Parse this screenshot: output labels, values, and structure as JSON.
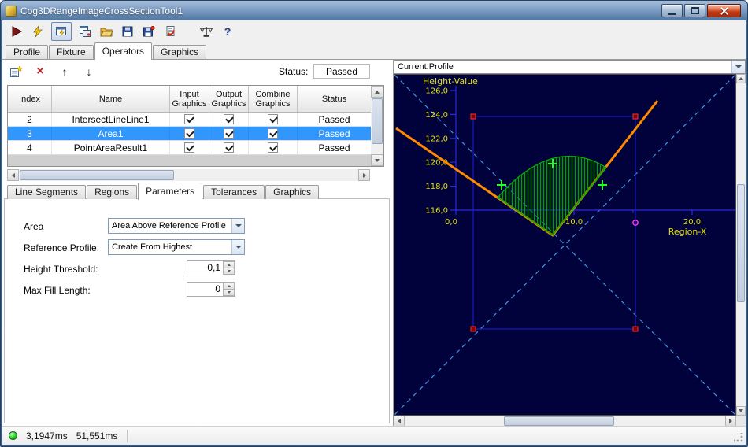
{
  "window": {
    "title": "Cog3DRangeImageCrossSectionTool1"
  },
  "toolbar": {
    "icons": [
      {
        "name": "run"
      },
      {
        "name": "run-continuous"
      },
      {
        "name": "tool-display"
      },
      {
        "name": "result-display"
      },
      {
        "name": "open-file"
      },
      {
        "name": "save-file"
      },
      {
        "name": "save-results"
      },
      {
        "name": "import"
      },
      {
        "name": "measure"
      },
      {
        "name": "help",
        "glyph": "?"
      }
    ]
  },
  "main_tabs": {
    "selected": "Operators",
    "items": [
      {
        "label": "Profile"
      },
      {
        "label": "Fixture"
      },
      {
        "label": "Operators"
      },
      {
        "label": "Graphics"
      }
    ]
  },
  "operators": {
    "toolbar": {
      "add": {
        "name": "add-operator"
      },
      "delete": {
        "name": "delete-operator",
        "glyph": "×"
      },
      "move_up": {
        "name": "move-up",
        "glyph": "↑"
      },
      "move_down": {
        "name": "move-down",
        "glyph": "↓"
      },
      "status_label": "Status:",
      "status_value": "Passed"
    },
    "table": {
      "headers": {
        "index": "Index",
        "name": "Name",
        "input": "Input Graphics",
        "output": "Output Graphics",
        "combine": "Combine Graphics",
        "status": "Status"
      },
      "rows": [
        {
          "index": "2",
          "name": "IntersectLineLine1",
          "input_checked": true,
          "output_checked": true,
          "combine_checked": true,
          "status": "Passed",
          "selected": false
        },
        {
          "index": "3",
          "name": "Area1",
          "input_checked": true,
          "output_checked": true,
          "combine_checked": true,
          "status": "Passed",
          "selected": true
        },
        {
          "index": "4",
          "name": "PointAreaResult1",
          "input_checked": true,
          "output_checked": true,
          "combine_checked": true,
          "status": "Passed",
          "selected": false
        }
      ]
    }
  },
  "sub_tabs": {
    "selected": "Parameters",
    "items": [
      {
        "label": "Line Segments"
      },
      {
        "label": "Regions"
      },
      {
        "label": "Parameters"
      },
      {
        "label": "Tolerances"
      },
      {
        "label": "Graphics"
      }
    ]
  },
  "parameters": {
    "area_label": "Area",
    "area_value": "Area Above Reference Profile",
    "reference_profile_label": "Reference Profile:",
    "reference_profile_value": "Create From Highest",
    "height_threshold_label": "Height Threshold:",
    "height_threshold_value": "0,1",
    "max_fill_length_label": "Max Fill Length:",
    "max_fill_length_value": "0"
  },
  "profile_view": {
    "source": "Current.Profile",
    "y_axis_label": "Height-Value",
    "x_axis_label": "Region-X",
    "y_ticks": [
      "126,0",
      "124,0",
      "122,0",
      "120,0",
      "118,0",
      "116,0"
    ],
    "x_ticks": [
      "0,0",
      "10,0",
      "20,0"
    ],
    "colors": {
      "background": "#01013c",
      "axis": "#2a2ae0",
      "tick_text": "#e0e000",
      "diagonal_guides": "#3f97e0",
      "region_outline": "#1a1ac0",
      "corner_handles": "#ff3030",
      "profile_line": "#ff8a00",
      "area_hatch": "#00b400",
      "point_markers": "#22ff22",
      "pick_marker": "#ff2cff"
    }
  },
  "status_bar": {
    "led_color": "#18c018",
    "time_1": "3,1947ms",
    "time_2": "51,551ms"
  },
  "accent": {
    "selection": "#3297fd"
  }
}
